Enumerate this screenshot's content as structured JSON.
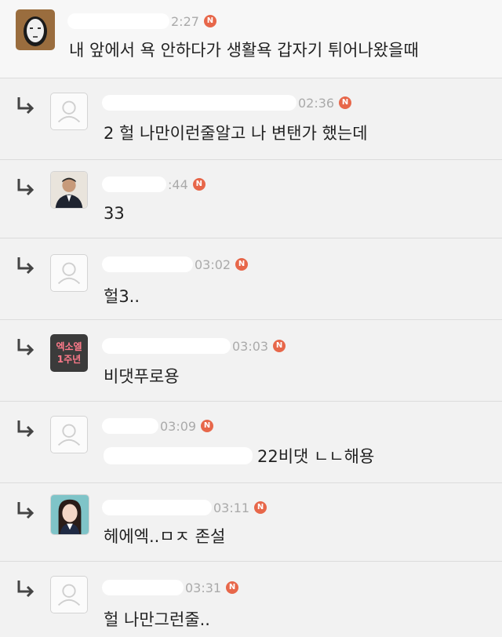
{
  "comments": [
    {
      "time": "2:27",
      "badge": "N",
      "text": "내 앞에서 욕 안하다가 생활욕 갑자기 튀어나왔을때",
      "avatar_icon": "mask-avatar-icon"
    },
    {
      "time": "02:36",
      "badge": "N",
      "text": "2 헐 나만이런줄알고 나 변탠가 했는데",
      "avatar_icon": "default-user-icon"
    },
    {
      "time": ":44",
      "badge": "N",
      "text": "33",
      "avatar_icon": "man-suit-avatar-icon"
    },
    {
      "time": "03:02",
      "badge": "N",
      "text": "헐3..",
      "avatar_icon": "default-user-icon"
    },
    {
      "time": "03:03",
      "badge": "N",
      "text": "비댓푸로용",
      "avatar_icon": "exo-anniversary-avatar-icon",
      "avatar_text_line1": "엑소엘",
      "avatar_text_line2": "1주년"
    },
    {
      "time": "03:09",
      "badge": "N",
      "text": "22비댓 ㄴㄴ해용",
      "avatar_icon": "default-user-icon"
    },
    {
      "time": "03:11",
      "badge": "N",
      "text": "헤에엑..ㅁㅈ 존설",
      "avatar_icon": "girl-avatar-icon"
    },
    {
      "time": "03:31",
      "badge": "N",
      "text": "헐 나만그런줄..",
      "avatar_icon": "default-user-icon"
    }
  ],
  "colors": {
    "badge": "#e7674a",
    "time": "#aaaaaa",
    "text": "#222222",
    "background": "#f2f2f2"
  }
}
